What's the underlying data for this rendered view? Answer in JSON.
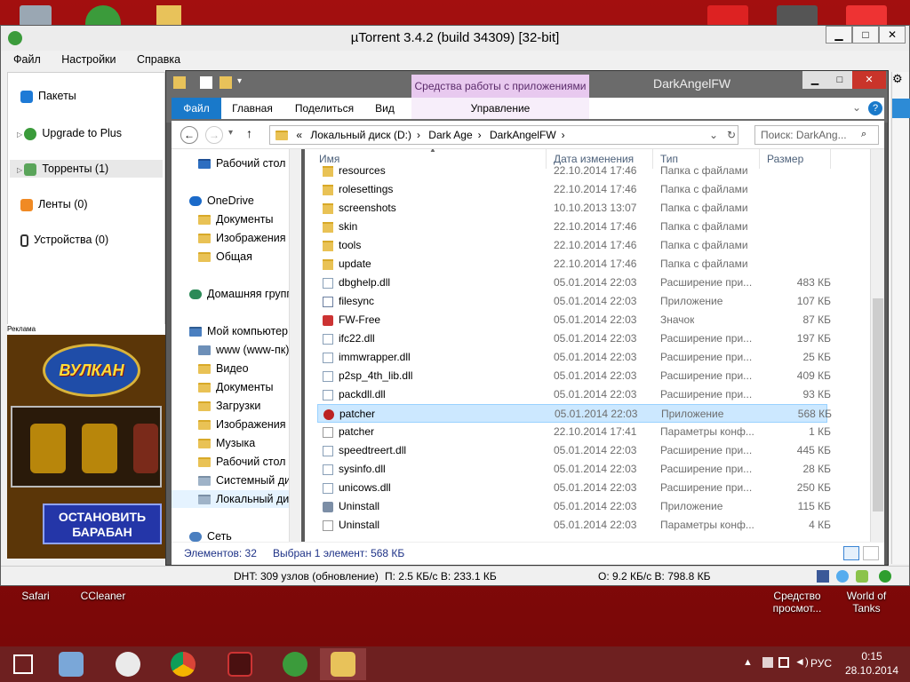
{
  "desktop": {
    "icons_bottom": [
      {
        "label": "Safari"
      },
      {
        "label": "CCleaner"
      },
      {
        "label": "Средство просмот..."
      },
      {
        "label": "World of Tanks"
      }
    ]
  },
  "utorrent": {
    "title": "µTorrent 3.4.2  (build 34309) [32-bit]",
    "menu": [
      "Файл",
      "Настройки",
      "Справка"
    ],
    "sidebar": [
      {
        "label": "Пакеты",
        "icon": "packages-icon"
      },
      {
        "label": "Upgrade to Plus",
        "icon": "utorrent-plus-icon"
      },
      {
        "label": "Торренты (1)",
        "icon": "torrents-icon"
      },
      {
        "label": "Ленты (0)",
        "icon": "rss-icon"
      },
      {
        "label": "Устройства (0)",
        "icon": "device-icon"
      }
    ],
    "ad_label": "Реклама",
    "ad_logo": "ВУЛКАН",
    "ad_button": "ОСТАНОВИТЬ БАРАБАН",
    "status": {
      "dht": "DHT: 309 узлов  (обновление)",
      "download": "П: 2.5 КБ/с В: 233.1 КБ",
      "upload": "О: 9.2 КБ/с В: 798.8 КБ"
    }
  },
  "explorer": {
    "title": "DarkAngelFW",
    "context_tab": "Средства работы с приложениями",
    "tabs": [
      "Файл",
      "Главная",
      "Поделиться",
      "Вид",
      "Управление"
    ],
    "breadcrumb": [
      "«",
      "Локальный диск (D:)",
      "Dark Age",
      "DarkAngelFW"
    ],
    "search_placeholder": "Поиск: DarkAng...",
    "nav": [
      {
        "label": "Рабочий стол",
        "indent": 1
      },
      {
        "label": "OneDrive",
        "indent": 0
      },
      {
        "label": "Документы",
        "indent": 1
      },
      {
        "label": "Изображения",
        "indent": 1
      },
      {
        "label": "Общая",
        "indent": 1
      },
      {
        "label": "Домашняя групп",
        "indent": 0
      },
      {
        "label": "Мой компьютер",
        "indent": 0
      },
      {
        "label": "www (www-пк)",
        "indent": 1
      },
      {
        "label": "Видео",
        "indent": 1
      },
      {
        "label": "Документы",
        "indent": 1
      },
      {
        "label": "Загрузки",
        "indent": 1
      },
      {
        "label": "Изображения",
        "indent": 1
      },
      {
        "label": "Музыка",
        "indent": 1
      },
      {
        "label": "Рабочий стол",
        "indent": 1
      },
      {
        "label": "Системный дис",
        "indent": 1
      },
      {
        "label": "Локальный дис",
        "indent": 1
      },
      {
        "label": "Сеть",
        "indent": 0
      }
    ],
    "columns": [
      "Имя",
      "Дата изменения",
      "Тип",
      "Размер"
    ],
    "files": [
      {
        "name": "resources",
        "date": "22.10.2014 17:46",
        "type": "Папка с файлами",
        "size": "",
        "icon": "folder"
      },
      {
        "name": "rolesettings",
        "date": "22.10.2014 17:46",
        "type": "Папка с файлами",
        "size": "",
        "icon": "folder"
      },
      {
        "name": "screenshots",
        "date": "10.10.2013 13:07",
        "type": "Папка с файлами",
        "size": "",
        "icon": "folder"
      },
      {
        "name": "skin",
        "date": "22.10.2014 17:46",
        "type": "Папка с файлами",
        "size": "",
        "icon": "folder"
      },
      {
        "name": "tools",
        "date": "22.10.2014 17:46",
        "type": "Папка с файлами",
        "size": "",
        "icon": "folder"
      },
      {
        "name": "update",
        "date": "22.10.2014 17:46",
        "type": "Папка с файлами",
        "size": "",
        "icon": "folder"
      },
      {
        "name": "dbghelp.dll",
        "date": "05.01.2014 22:03",
        "type": "Расширение при...",
        "size": "483 КБ",
        "icon": "dll"
      },
      {
        "name": "filesync",
        "date": "05.01.2014 22:03",
        "type": "Приложение",
        "size": "107 КБ",
        "icon": "exe"
      },
      {
        "name": "FW-Free",
        "date": "05.01.2014 22:03",
        "type": "Значок",
        "size": "87 КБ",
        "icon": "ico"
      },
      {
        "name": "ifc22.dll",
        "date": "05.01.2014 22:03",
        "type": "Расширение при...",
        "size": "197 КБ",
        "icon": "dll"
      },
      {
        "name": "immwrapper.dll",
        "date": "05.01.2014 22:03",
        "type": "Расширение при...",
        "size": "25 КБ",
        "icon": "dll"
      },
      {
        "name": "p2sp_4th_lib.dll",
        "date": "05.01.2014 22:03",
        "type": "Расширение при...",
        "size": "409 КБ",
        "icon": "dll"
      },
      {
        "name": "packdll.dll",
        "date": "05.01.2014 22:03",
        "type": "Расширение при...",
        "size": "93 КБ",
        "icon": "dll"
      },
      {
        "name": "patcher",
        "date": "05.01.2014 22:03",
        "type": "Приложение",
        "size": "568 КБ",
        "icon": "patcher",
        "selected": true
      },
      {
        "name": "patcher",
        "date": "22.10.2014 17:41",
        "type": "Параметры конф...",
        "size": "1 КБ",
        "icon": "cfg"
      },
      {
        "name": "speedtreert.dll",
        "date": "05.01.2014 22:03",
        "type": "Расширение при...",
        "size": "445 КБ",
        "icon": "dll"
      },
      {
        "name": "sysinfo.dll",
        "date": "05.01.2014 22:03",
        "type": "Расширение при...",
        "size": "28 КБ",
        "icon": "dll"
      },
      {
        "name": "unicows.dll",
        "date": "05.01.2014 22:03",
        "type": "Расширение при...",
        "size": "250 КБ",
        "icon": "dll"
      },
      {
        "name": "Uninstall",
        "date": "05.01.2014 22:03",
        "type": "Приложение",
        "size": "115 КБ",
        "icon": "uninstall"
      },
      {
        "name": "Uninstall",
        "date": "05.01.2014 22:03",
        "type": "Параметры конф...",
        "size": "4 КБ",
        "icon": "cfg"
      }
    ],
    "status_count": "Элементов: 32",
    "status_selected": "Выбран 1 элемент: 568 КБ"
  },
  "taskbar": {
    "lang": "РУС",
    "time": "0:15",
    "date": "28.10.2014"
  }
}
